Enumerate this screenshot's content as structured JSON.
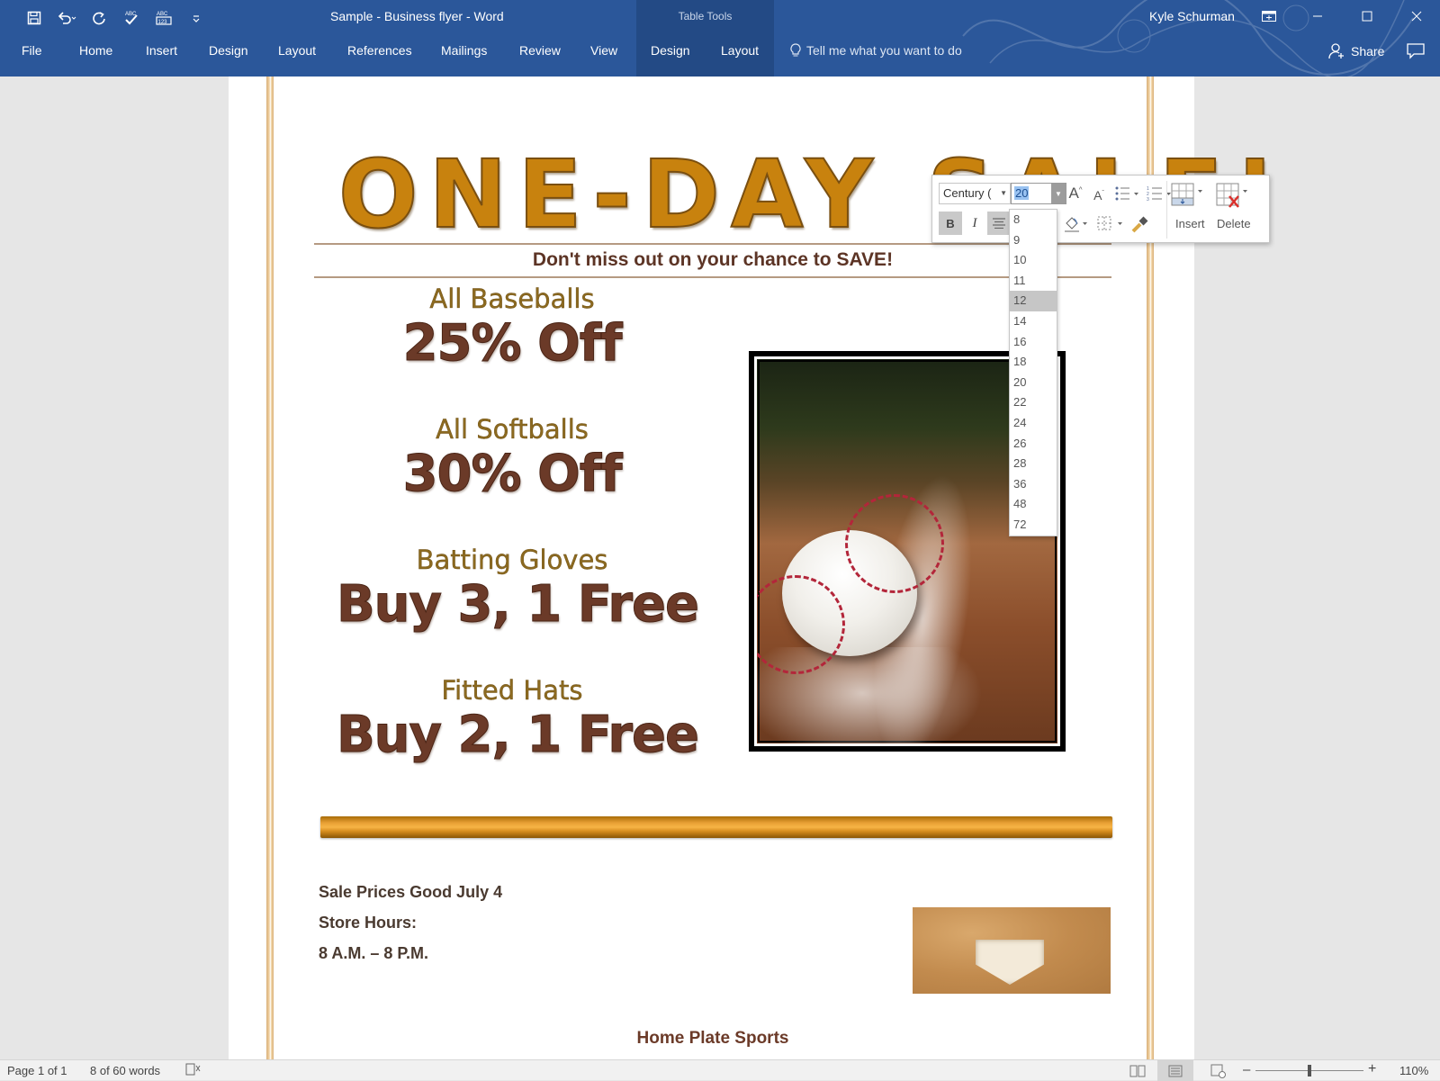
{
  "window": {
    "title": "Sample - Business flyer  -  Word",
    "user": "Kyle Schurman",
    "controls": [
      "ribbon-display-options",
      "minimize",
      "maximize",
      "close"
    ]
  },
  "quick_access": [
    "save",
    "undo",
    "redo",
    "spelling-grammar",
    "word-count",
    "customize"
  ],
  "context_group": {
    "label": "Table Tools"
  },
  "tabs": [
    {
      "label": "File"
    },
    {
      "label": "Home"
    },
    {
      "label": "Insert"
    },
    {
      "label": "Design"
    },
    {
      "label": "Layout"
    },
    {
      "label": "References"
    },
    {
      "label": "Mailings"
    },
    {
      "label": "Review"
    },
    {
      "label": "View"
    },
    {
      "label": "Design"
    },
    {
      "label": "Layout"
    }
  ],
  "tell_me": {
    "placeholder": "Tell me what you want to do"
  },
  "share": {
    "label": "Share"
  },
  "document": {
    "headline": "ONE-DAY SALE!",
    "tagline": "Don't miss out on your chance to SAVE!",
    "deals": [
      {
        "category": "All Baseballs",
        "offer": "25% Off"
      },
      {
        "category": "All Softballs",
        "offer": "30% Off"
      },
      {
        "category": "Batting Gloves",
        "offer": "Buy 3, 1 Free"
      },
      {
        "category": "Fitted Hats",
        "offer": "Buy 2, 1 Free"
      }
    ],
    "info": [
      "Sale Prices Good July 4",
      "Store Hours:",
      "8 A.M. – 8 P.M."
    ],
    "store_name": "Home Plate Sports",
    "colors": {
      "headline": "#c8820e",
      "offer": "#6b3a28",
      "category": "#8c6a20",
      "border": "#d9b07a"
    }
  },
  "mini_toolbar": {
    "font": "Century (",
    "size": "20",
    "bold_label": "B",
    "italic_label": "I",
    "insert_label": "Insert",
    "delete_label": "Delete",
    "size_options": [
      "8",
      "9",
      "10",
      "11",
      "12",
      "14",
      "16",
      "18",
      "20",
      "22",
      "24",
      "26",
      "28",
      "36",
      "48",
      "72"
    ],
    "hovered_size": "12"
  },
  "status": {
    "page": "Page 1 of 1",
    "words": "8 of 60 words",
    "zoom": "110%",
    "zoom_minus": "–",
    "zoom_plus": "+"
  }
}
